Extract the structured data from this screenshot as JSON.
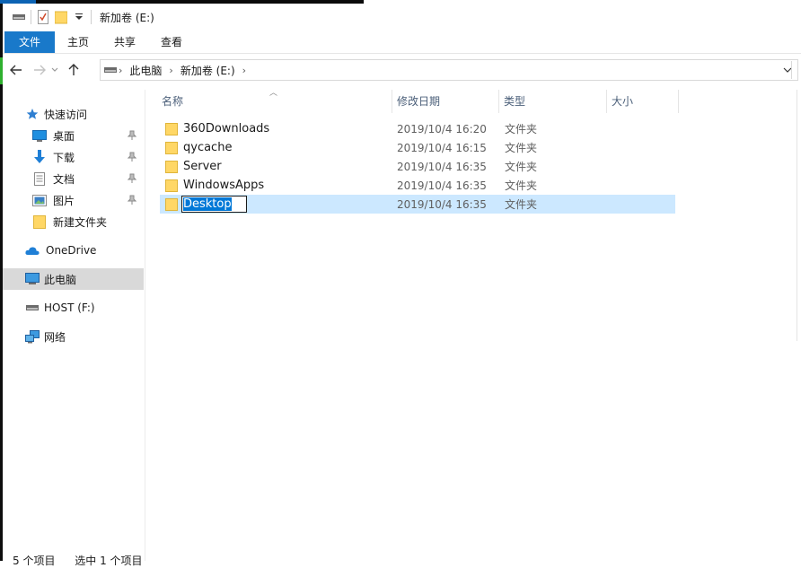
{
  "window": {
    "title": "新加卷 (E:)"
  },
  "ribbon": {
    "tabs": [
      "文件",
      "主页",
      "共享",
      "查看"
    ]
  },
  "address": {
    "crumbs": [
      "此电脑",
      "新加卷 (E:)"
    ]
  },
  "sidebar": {
    "quick_access": "快速访问",
    "pinned": [
      {
        "label": "桌面",
        "icon": "desktop-icon"
      },
      {
        "label": "下载",
        "icon": "download-icon"
      },
      {
        "label": "文档",
        "icon": "document-icon"
      },
      {
        "label": "图片",
        "icon": "picture-icon"
      },
      {
        "label": "新建文件夹",
        "icon": "folder-icon"
      }
    ],
    "onedrive": "OneDrive",
    "this_pc": "此电脑",
    "host": "HOST (F:)",
    "network": "网络"
  },
  "columns": {
    "name": "名称",
    "date": "修改日期",
    "type": "类型",
    "size": "大小"
  },
  "files": [
    {
      "name": "360Downloads",
      "date": "2019/10/4 16:20",
      "type": "文件夹"
    },
    {
      "name": "qycache",
      "date": "2019/10/4 16:15",
      "type": "文件夹"
    },
    {
      "name": "Server",
      "date": "2019/10/4 16:35",
      "type": "文件夹"
    },
    {
      "name": "WindowsApps",
      "date": "2019/10/4 16:35",
      "type": "文件夹"
    },
    {
      "name": "Desktop",
      "date": "2019/10/4 16:35",
      "type": "文件夹"
    }
  ],
  "status": {
    "count": "5 个项目",
    "selected": "选中 1 个项目"
  },
  "colors": {
    "accent": "#1979ca",
    "selection": "#cce8ff",
    "folder": "#ffd766"
  }
}
